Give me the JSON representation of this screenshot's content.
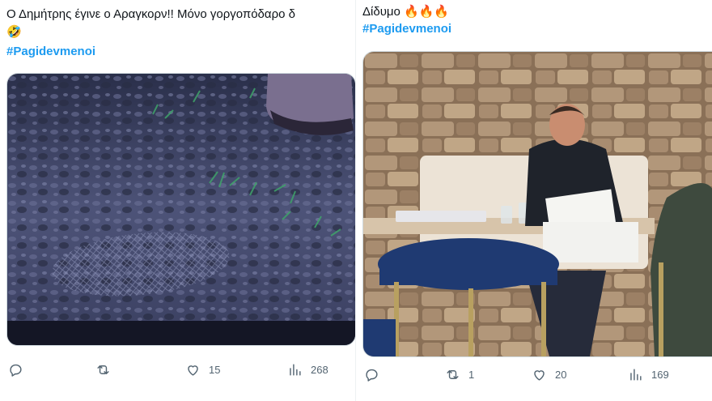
{
  "left_tweet": {
    "text_line1": "Ο Δημήτρης έγινε ο Αραγκορν!! Μόνο γοργοπόδαρο δ",
    "text_line2": "🤣",
    "hashtag": "#Pagidevmenoi",
    "actions": {
      "reply_count": "",
      "retweet_count": "",
      "like_count": "15",
      "views_count": "268"
    }
  },
  "right_tweet": {
    "text_line1": "Δίδυμο 🔥🔥🔥",
    "hashtag": "#Pagidevmenoi",
    "actions": {
      "reply_count": "",
      "retweet_count": "1",
      "like_count": "20",
      "views_count": "169"
    }
  },
  "colors": {
    "hashtag": "#1d9bf0",
    "action_gray": "#536471",
    "text": "#0f1419"
  },
  "icons": [
    "reply-icon",
    "retweet-icon",
    "like-icon",
    "views-icon"
  ]
}
